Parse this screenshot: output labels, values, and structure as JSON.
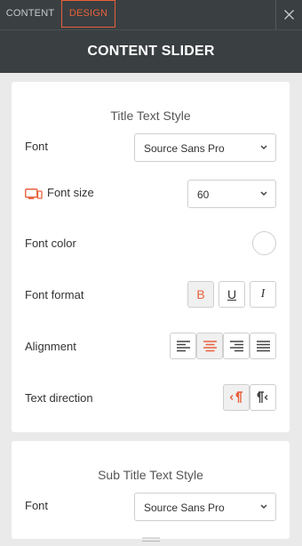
{
  "tabs": {
    "content": "CONTENT",
    "design": "DESIGN"
  },
  "header": {
    "title": "CONTENT SLIDER"
  },
  "title_style": {
    "heading": "Title Text Style",
    "font_label": "Font",
    "font_value": "Source Sans Pro",
    "font_size_label": "Font size",
    "font_size_value": "60",
    "font_color_label": "Font color",
    "font_format_label": "Font format",
    "format_buttons": {
      "bold": "B",
      "underline": "U",
      "italic": "I"
    },
    "alignment_label": "Alignment",
    "text_direction_label": "Text direction"
  },
  "subtitle_style": {
    "heading": "Sub Title Text Style",
    "font_label": "Font",
    "font_value": "Source Sans Pro"
  },
  "colors": {
    "accent": "#e8613c",
    "header_bg": "#3a3f41",
    "panel_bg": "#eaeaea"
  }
}
